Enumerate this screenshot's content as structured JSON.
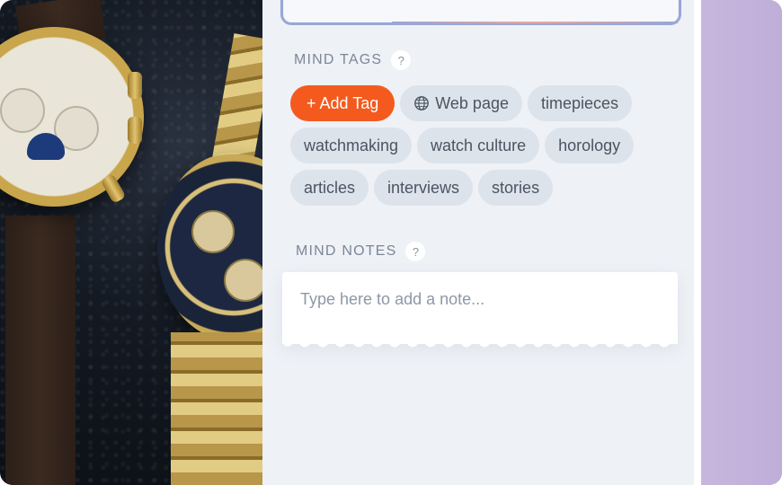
{
  "mind_tags": {
    "label": "MIND TAGS",
    "help": "?",
    "add_tag_label": "+ Add Tag",
    "tags": [
      {
        "label": "Web page",
        "icon": "globe-icon"
      },
      {
        "label": "timepieces"
      },
      {
        "label": "watchmaking"
      },
      {
        "label": "watch culture"
      },
      {
        "label": "horology"
      },
      {
        "label": "articles"
      },
      {
        "label": "interviews"
      },
      {
        "label": "stories"
      }
    ]
  },
  "mind_notes": {
    "label": "MIND NOTES",
    "help": "?",
    "placeholder": "Type here to add a note..."
  },
  "colors": {
    "accent": "#f45a1e",
    "panel": "#eef1f6",
    "tag_bg": "#dde3ea",
    "side_purple": "#c5b3da"
  }
}
